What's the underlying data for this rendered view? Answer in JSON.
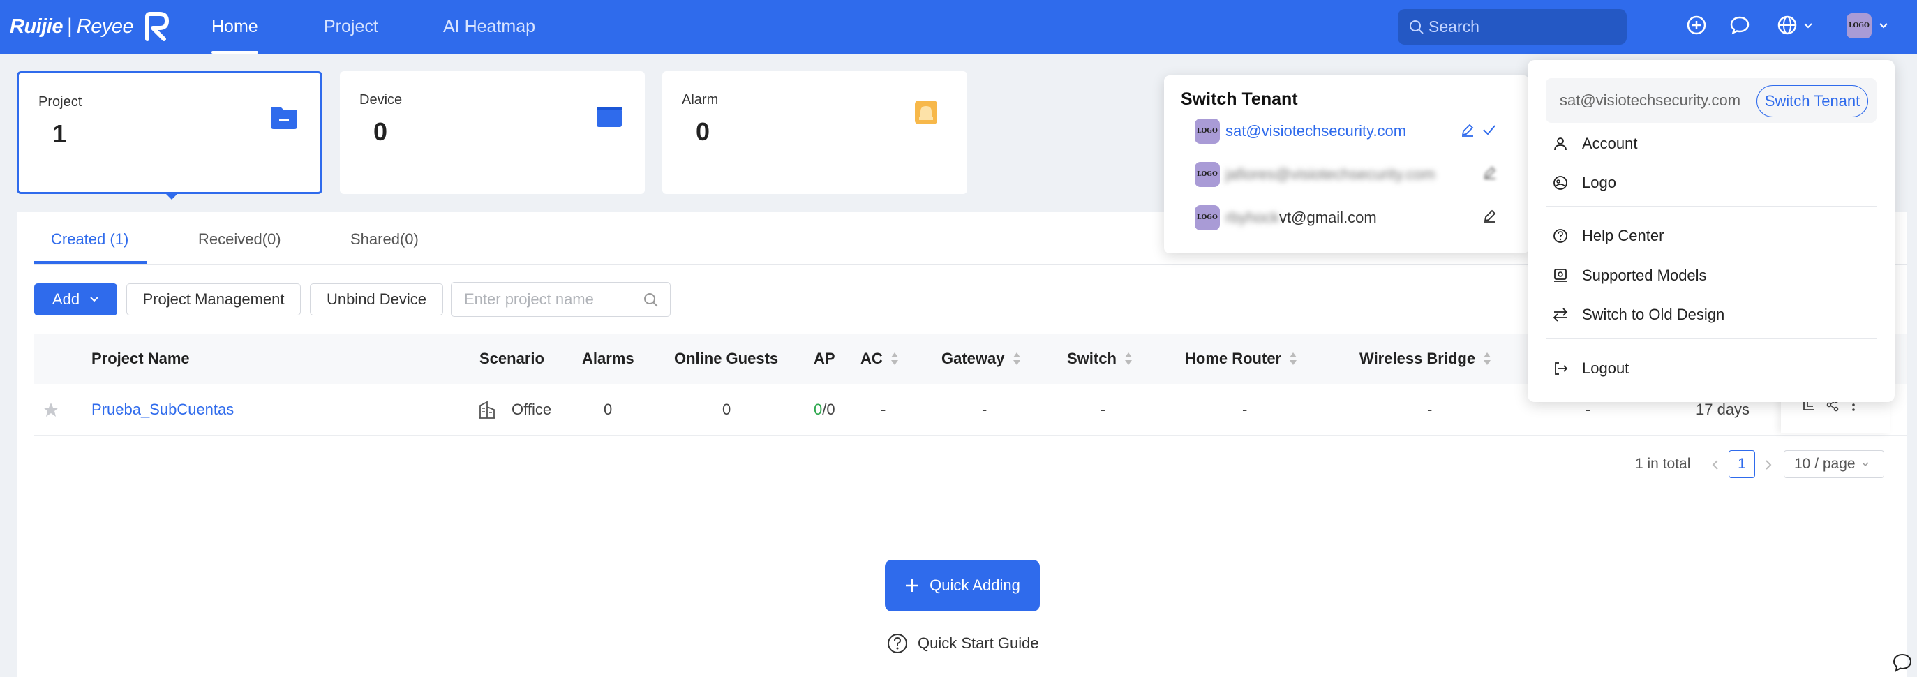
{
  "brand": {
    "name1": "Ruijie",
    "name2": "Reyee"
  },
  "nav": [
    {
      "label": "Home",
      "active": true
    },
    {
      "label": "Project",
      "active": false
    },
    {
      "label": "AI Heatmap",
      "active": false
    }
  ],
  "search": {
    "placeholder": "Search"
  },
  "header_icons": [
    "plus-circle-icon",
    "message-icon",
    "globe-icon",
    "avatar-logo"
  ],
  "avatar_text": "LOGO",
  "cards": [
    {
      "label": "Project",
      "value": "1"
    },
    {
      "label": "Device",
      "value": "0"
    },
    {
      "label": "Alarm",
      "value": "0"
    }
  ],
  "tabs": [
    {
      "label": "Created (1)",
      "active": true
    },
    {
      "label": "Received(0)",
      "active": false
    },
    {
      "label": "Shared(0)",
      "active": false
    }
  ],
  "toolbar": {
    "add": "Add",
    "project_management": "Project Management",
    "unbind_device": "Unbind Device",
    "search_placeholder": "Enter project name"
  },
  "table": {
    "columns": [
      "Project Name",
      "Scenario",
      "Alarms",
      "Online Guests",
      "AP",
      "AC",
      "Gateway",
      "Switch",
      "Home Router",
      "Wireless Bridge"
    ],
    "rows": [
      {
        "project_name": "Prueba_SubCuentas",
        "scenario": "Office",
        "alarms": "0",
        "online_guests": "0",
        "ap_online": "0",
        "ap_total": "/0",
        "ac": "-",
        "gateway": "-",
        "switch": "-",
        "home_router": "-",
        "wireless_bridge": "-",
        "extra": "-",
        "duration": "17 days"
      }
    ]
  },
  "pagination": {
    "total": "1 in total",
    "page": "1",
    "page_size": "10 / page"
  },
  "quick_adding": "Quick Adding",
  "quick_start_guide": "Quick Start Guide",
  "colors": {
    "primary": "#2f6bec",
    "background": "#eef1f5",
    "ap_online": "#2fa84f",
    "alarm_icon": "#f7b84a"
  },
  "switch_tenant": {
    "title": "Switch Tenant",
    "tenants": [
      {
        "email": "sat@visiotechsecurity.com",
        "current": true
      },
      {
        "email": "jafiores@visiotechsecurity.com",
        "current": false,
        "blurred": true
      },
      {
        "email_prefix": "rbyhock",
        "email_suffix": "vt@gmail.com",
        "current": false
      }
    ]
  },
  "account_menu": {
    "email": "sat@visiotechsecurity.com",
    "switch_tenant": "Switch Tenant",
    "items": [
      "Account",
      "Logo",
      "Help Center",
      "Supported Models",
      "Switch to Old Design",
      "Logout"
    ]
  }
}
